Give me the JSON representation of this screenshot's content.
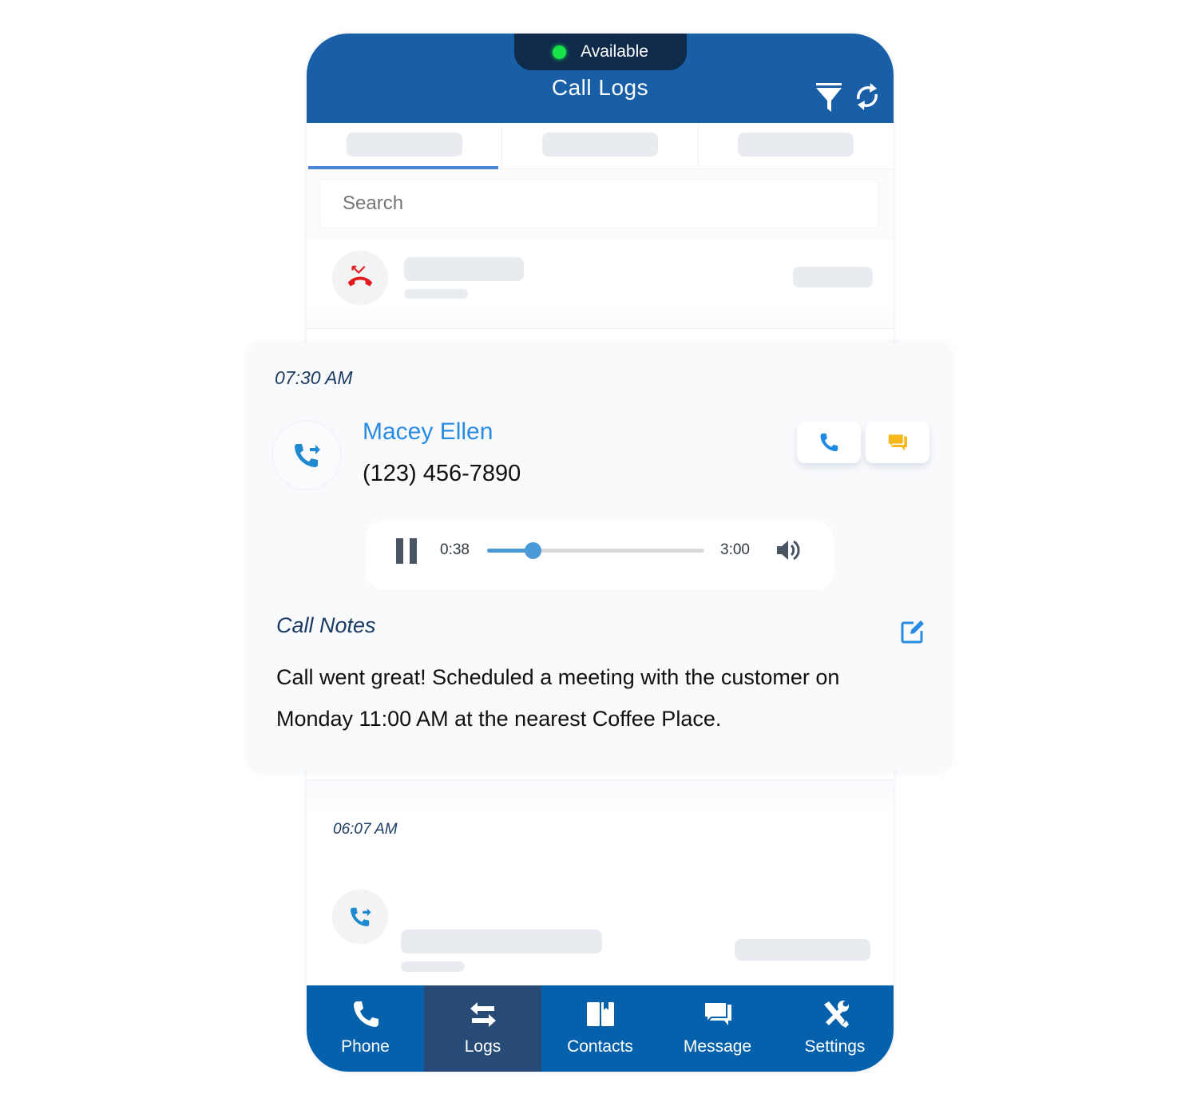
{
  "header": {
    "status": "Available",
    "status_color": "#19e34a",
    "title": "Call Logs",
    "filter_icon": "filter-icon",
    "refresh_icon": "refresh-icon"
  },
  "tabs": [
    {
      "active": true
    },
    {
      "active": false
    },
    {
      "active": false
    }
  ],
  "search": {
    "placeholder": "Search",
    "value": ""
  },
  "logs": [
    {
      "type": "missed",
      "icon": "missed-call-icon",
      "icon_color": "#e0191b"
    },
    {
      "expanded": true,
      "time": "07:30 AM",
      "type": "outgoing",
      "icon": "outgoing-call-icon",
      "name": "Macey Ellen",
      "phone": "(123) 456-7890",
      "actions": [
        {
          "name": "call-button",
          "icon": "phone-icon",
          "color": "#1e88e5"
        },
        {
          "name": "message-button",
          "icon": "chat-icon",
          "color": "#f6b81b"
        }
      ],
      "recording": {
        "current": "0:38",
        "total": "3:00",
        "progress": 0.211,
        "state": "playing"
      },
      "notes_title": "Call Notes",
      "notes": "Call went great! Scheduled a meeting with the customer on Monday 11:00 AM at the nearest Coffee Place."
    },
    {
      "time": "06:07 AM",
      "type": "outgoing",
      "icon": "outgoing-call-icon"
    }
  ],
  "nav": [
    {
      "label": "Phone",
      "icon": "phone-icon",
      "active": false
    },
    {
      "label": "Logs",
      "icon": "transfer-arrows-icon",
      "active": true
    },
    {
      "label": "Contacts",
      "icon": "contacts-book-icon",
      "active": false
    },
    {
      "label": "Message",
      "icon": "message-icon",
      "active": false
    },
    {
      "label": "Settings",
      "icon": "tools-icon",
      "active": false
    }
  ],
  "colors": {
    "header": "#185fa8",
    "nav": "#0661ad",
    "nav_active": "#274a76",
    "accent": "#2a8be3"
  }
}
